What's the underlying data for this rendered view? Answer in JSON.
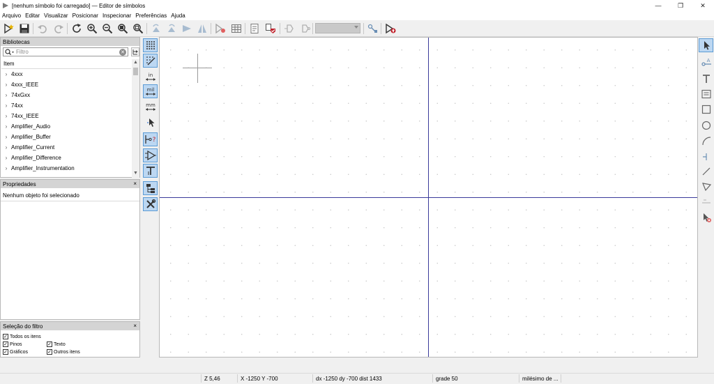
{
  "window": {
    "title": "[nenhum símbolo foi carregado] — Editor de símbolos",
    "controls": {
      "minimize": "—",
      "restore": "❐",
      "close": "✕"
    }
  },
  "menu": {
    "items": [
      "Arquivo",
      "Editar",
      "Visualizar",
      "Posicionar",
      "Inspecionar",
      "Preferências",
      "Ajuda"
    ]
  },
  "colors": {
    "accent": "#5b9bd5",
    "active_bg": "#bcd7f2",
    "axis": "#3a3a9a",
    "error_red": "#c0202a"
  },
  "toolbar": {
    "icons": [
      "new-symbol-icon",
      "save-icon",
      "undo-icon",
      "redo-icon",
      "refresh-icon",
      "zoom-in-icon",
      "zoom-out-icon",
      "zoom-fit-icon",
      "zoom-selection-icon",
      "rotate-ccw-icon",
      "rotate-cw-icon",
      "mirror-vertical-icon",
      "mirror-horizontal-icon",
      "symbol-properties-icon",
      "pin-table-icon",
      "datasheet-icon",
      "check-symbol-icon",
      "body-style-icon",
      "body-style-alt-icon",
      "unit-selector",
      "pin-editor-icon",
      "add-to-schematic-icon"
    ]
  },
  "libraries": {
    "title": "Bibliotecas",
    "close": "×",
    "search_placeholder": "Filtro",
    "search_value": "",
    "column_header": "Item",
    "items": [
      "4xxx",
      "4xxx_IEEE",
      "74xGxx",
      "74xx",
      "74xx_IEEE",
      "Amplifier_Audio",
      "Amplifier_Buffer",
      "Amplifier_Current",
      "Amplifier_Difference",
      "Amplifier_Instrumentation"
    ]
  },
  "properties": {
    "title": "Propriedades",
    "close": "×",
    "message": "Nenhum objeto foi selecionado"
  },
  "filter": {
    "title": "Seleção do filtro",
    "close": "×",
    "all_items": "Todos os itens",
    "pins": "Pinos",
    "text": "Texto",
    "graphics": "Gráficos",
    "other_items": "Outros itens"
  },
  "left_tools": {
    "icons": [
      "grid-icon",
      "grid-overrides-icon",
      "units-inches-icon",
      "units-mils-icon",
      "units-mm-icon",
      "cursor-full-icon",
      "show-pin-electrical-type-icon",
      "show-hidden-pins-icon",
      "show-pin-numbers-icon",
      "symbol-hierarchy-icon",
      "properties-panel-icon"
    ],
    "units": {
      "inches": "in",
      "mils": "mil",
      "mm": "mm"
    }
  },
  "right_tools": {
    "icons": [
      "select-arrow-icon",
      "add-pin-icon",
      "add-text-icon",
      "add-textbox-icon",
      "add-rectangle-icon",
      "add-circle-icon",
      "add-arc-icon",
      "add-anchor-icon",
      "add-line-icon",
      "add-polygon-icon",
      "add-field-icon",
      "delete-tool-icon"
    ]
  },
  "status": {
    "zoom": "Z 5,46",
    "xy": "X -1250  Y -700",
    "dxdy": "dx -1250  dy -700  dist 1433",
    "grid": "grade 50",
    "units": "milésimo de ..."
  }
}
